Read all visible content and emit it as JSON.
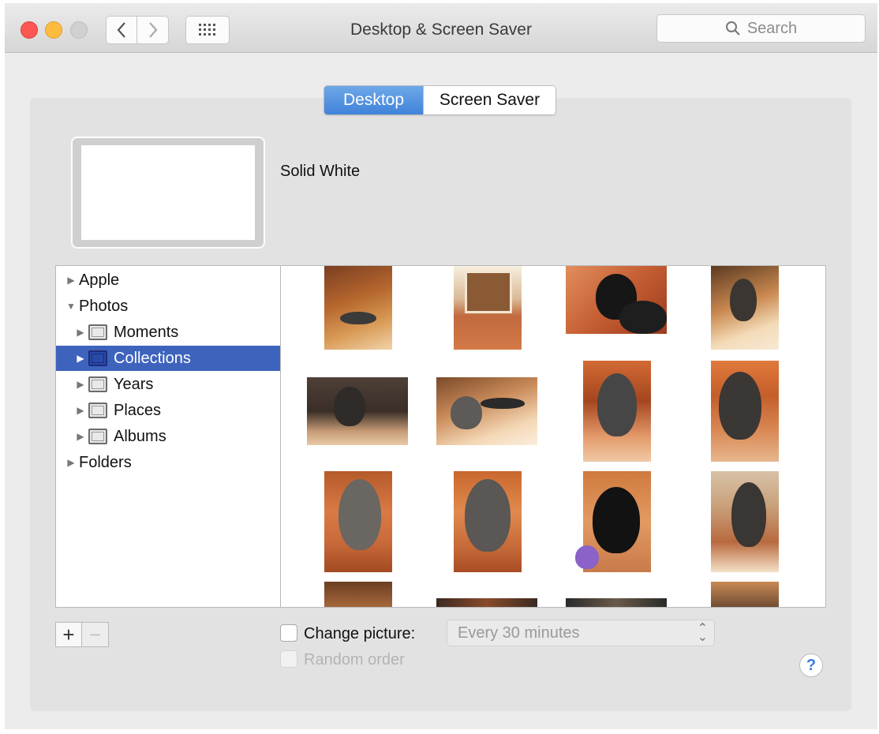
{
  "window": {
    "title": "Desktop & Screen Saver",
    "search_placeholder": "Search"
  },
  "tabs": [
    {
      "label": "Desktop",
      "selected": true
    },
    {
      "label": "Screen Saver",
      "selected": false
    }
  ],
  "preview": {
    "name": "Solid White"
  },
  "sidebar": {
    "items": [
      {
        "label": "Apple",
        "expanded": false
      },
      {
        "label": "Photos",
        "expanded": true
      },
      {
        "label": "Moments",
        "expanded": false
      },
      {
        "label": "Collections",
        "expanded": false,
        "selected": true
      },
      {
        "label": "Years",
        "expanded": false
      },
      {
        "label": "Places",
        "expanded": false
      },
      {
        "label": "Albums",
        "expanded": false
      },
      {
        "label": "Folders",
        "expanded": false
      }
    ]
  },
  "controls": {
    "add_label": "+",
    "remove_label": "−",
    "change_picture_label": "Change picture:",
    "change_picture_checked": false,
    "interval_value": "Every 30 minutes",
    "random_order_label": "Random order",
    "random_order_checked": false,
    "help_label": "?"
  },
  "colors": {
    "accent": "#3d63bd",
    "tab_active": "#4a8ae0",
    "close": "#fc5753",
    "minimize": "#fdbc40"
  },
  "icons": {
    "back": "chevron-left-icon",
    "forward": "chevron-right-icon",
    "grid": "grid-icon",
    "search": "search-icon",
    "help": "help-icon"
  }
}
